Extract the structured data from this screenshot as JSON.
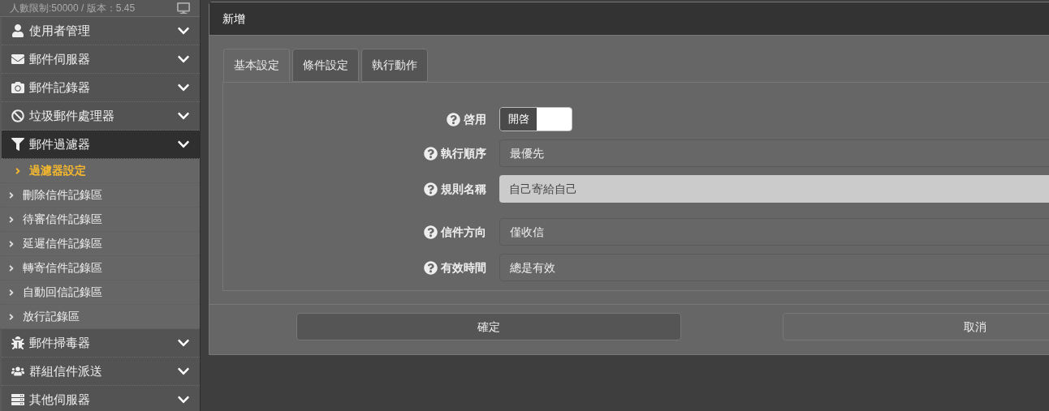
{
  "sidebar": {
    "header": {
      "text": "人數限制:50000 / 版本：5.45"
    },
    "menu": [
      {
        "label": "使用者管理",
        "expanded": false
      },
      {
        "label": "郵件伺服器",
        "expanded": false
      },
      {
        "label": "郵件記錄器",
        "expanded": false
      },
      {
        "label": "垃圾郵件處理器",
        "expanded": false
      },
      {
        "label": "郵件過濾器",
        "expanded": true,
        "children": [
          {
            "label": "過濾器設定",
            "selected": true
          },
          {
            "label": "刪除信件記錄區",
            "selected": false
          },
          {
            "label": "待審信件記錄區",
            "selected": false
          },
          {
            "label": "延遲信件記錄區",
            "selected": false
          },
          {
            "label": "轉寄信件記錄區",
            "selected": false
          },
          {
            "label": "自動回信記錄區",
            "selected": false
          },
          {
            "label": "放行記錄區",
            "selected": false
          }
        ]
      },
      {
        "label": "郵件掃毒器",
        "expanded": false
      },
      {
        "label": "群組信件派送",
        "expanded": false
      },
      {
        "label": "其他伺服器",
        "expanded": false
      }
    ]
  },
  "dialog": {
    "title": "新增",
    "tabs": [
      {
        "label": "基本設定",
        "selected": true
      },
      {
        "label": "條件設定",
        "selected": false
      },
      {
        "label": "執行動作",
        "selected": false
      }
    ],
    "fields": [
      {
        "kind": "toggle",
        "label": "啓用",
        "on_label": "開啓",
        "on": true
      },
      {
        "kind": "select",
        "label": "執行順序",
        "value": "最優先"
      },
      {
        "kind": "text",
        "label": "規則名稱",
        "value": "自己寄給自己",
        "readonly": true
      },
      {
        "kind": "select",
        "label": "信件方向",
        "value": "僅收信"
      },
      {
        "kind": "select",
        "label": "有效時間",
        "value": "總是有效"
      }
    ],
    "buttons": [
      {
        "label": "確定",
        "kind": "primary"
      },
      {
        "label": "取消",
        "kind": "secondary"
      }
    ]
  }
}
